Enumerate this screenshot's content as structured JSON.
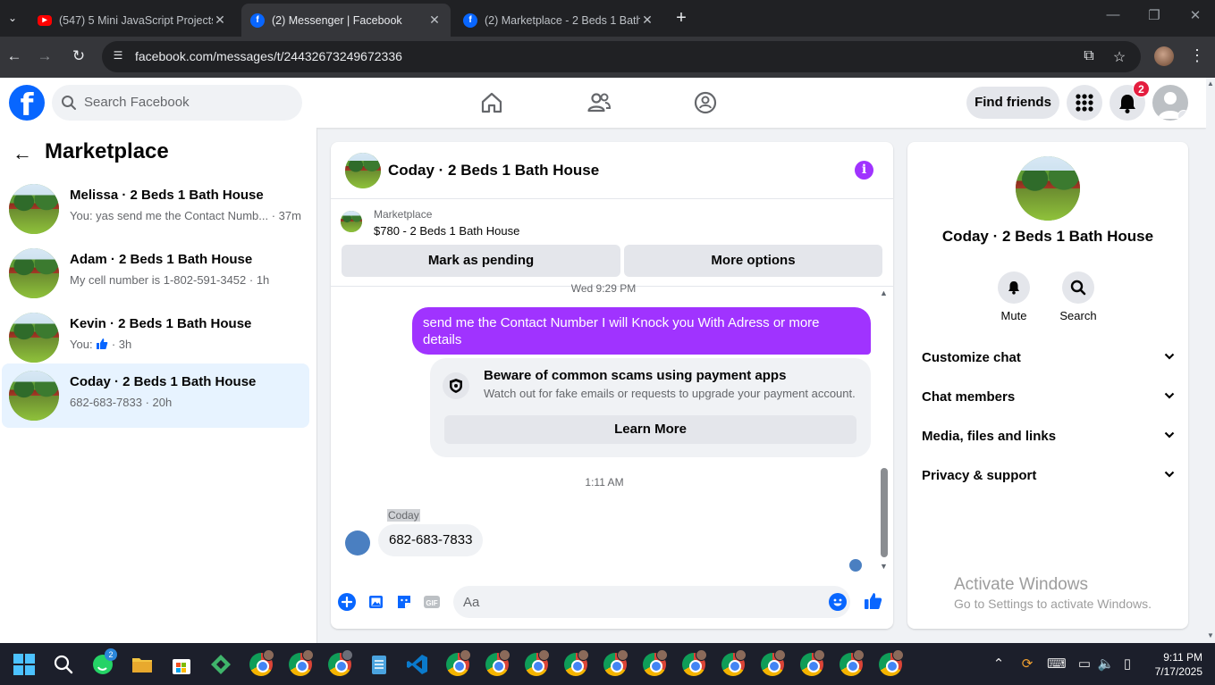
{
  "browser": {
    "tabs": [
      {
        "title": "(547) 5 Mini JavaScript Projects",
        "favicon": "youtube-icon",
        "active": false
      },
      {
        "title": "(2) Messenger | Facebook",
        "favicon": "facebook-icon",
        "active": true
      },
      {
        "title": "(2) Marketplace - 2 Beds 1 Bath",
        "favicon": "facebook-icon",
        "active": false
      }
    ],
    "url": "facebook.com/messages/t/24432673249672336"
  },
  "header": {
    "search_placeholder": "Search Facebook",
    "find_friends": "Find friends",
    "notification_count": "2",
    "brand_color": "#0866ff"
  },
  "sidebar": {
    "title": "Marketplace",
    "conversations": [
      {
        "name": "Melissa · 2 Beds 1 Bath House",
        "preview": "You: yas send me the Contact Numb... · 37m",
        "active": false
      },
      {
        "name": "Adam · 2 Beds 1 Bath House",
        "preview": "My cell number is 1-802-591-3452 · 1h",
        "active": false
      },
      {
        "name": "Kevin · 2 Beds 1 Bath House",
        "preview_prefix": "You:",
        "preview_suffix": "· 3h",
        "preview_icon": "thumbs-up-icon",
        "active": false
      },
      {
        "name": "Coday · 2 Beds 1 Bath House",
        "preview": "682-683-7833 · 20h",
        "active": true
      }
    ]
  },
  "chat": {
    "title": "Coday · 2 Beds 1 Bath House",
    "marketplace_label": "Marketplace",
    "listing": "$780 - 2 Beds 1 Bath House",
    "mark_pending": "Mark as pending",
    "more_options": "More options",
    "cut_time": "Wed 9:29 PM",
    "outgoing_message": "send me the Contact Number I will Knock you With Adress or more details",
    "scam_title": "Beware of common scams using payment apps",
    "scam_body": "Watch out for fake emails or requests to upgrade your payment account.",
    "learn_more": "Learn More",
    "time_separator": "1:11 AM",
    "sender_name": "Coday",
    "incoming_message": "682-683-7833",
    "composer_placeholder": "Aa",
    "accent_color": "#a033ff"
  },
  "info_panel": {
    "name": "Coday · 2 Beds 1 Bath House",
    "mute": "Mute",
    "search": "Search",
    "sections": [
      "Customize chat",
      "Chat members",
      "Media, files and links",
      "Privacy & support"
    ],
    "watermark_title": "Activate Windows",
    "watermark_sub": "Go to Settings to activate Windows."
  },
  "taskbar": {
    "time": "9:11 PM",
    "date": "7/17/2025",
    "whatsapp_badge": "2"
  }
}
